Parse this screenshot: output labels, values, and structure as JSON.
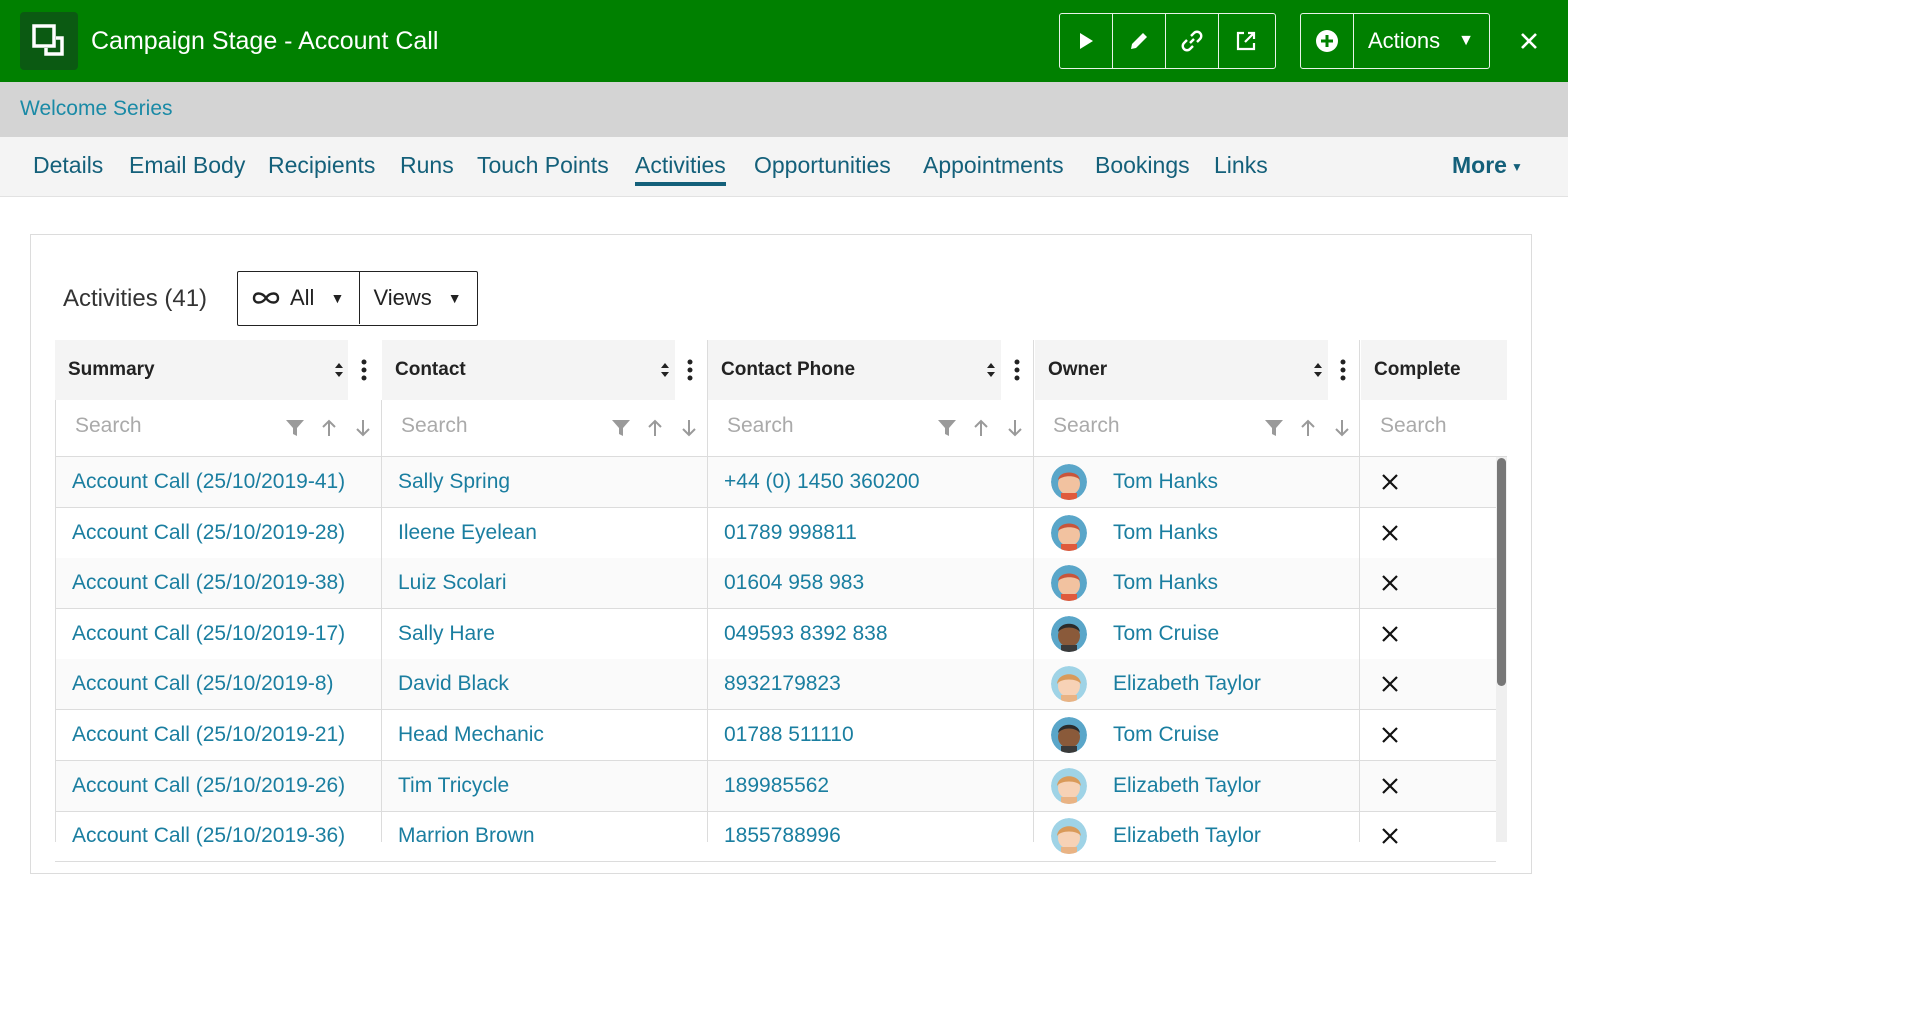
{
  "header": {
    "title": "Campaign Stage - Account Call",
    "toolbar": [
      {
        "name": "run-button",
        "icon": "play-icon"
      },
      {
        "name": "edit-button",
        "icon": "pencil-icon"
      },
      {
        "name": "link-button",
        "icon": "link-icon"
      },
      {
        "name": "open-external-button",
        "icon": "external-link-icon"
      }
    ],
    "actions_label": "Actions",
    "colors": {
      "bar": "#008000",
      "icon_bg": "#0b5a12"
    }
  },
  "breadcrumb": {
    "label": "Welcome Series"
  },
  "tabs": [
    {
      "label": "Details"
    },
    {
      "label": "Email Body"
    },
    {
      "label": "Recipients"
    },
    {
      "label": "Runs"
    },
    {
      "label": "Touch Points"
    },
    {
      "label": "Activities",
      "active": true
    },
    {
      "label": "Opportunities"
    },
    {
      "label": "Appointments"
    },
    {
      "label": "Bookings"
    },
    {
      "label": "Links"
    }
  ],
  "more_label": "More",
  "activities": {
    "title": "Activities",
    "count": "(41)",
    "filter_label": "All",
    "views_label": "Views"
  },
  "columns": [
    {
      "label": "Summary",
      "placeholder": "Search"
    },
    {
      "label": "Contact",
      "placeholder": "Search"
    },
    {
      "label": "Contact Phone",
      "placeholder": "Search"
    },
    {
      "label": "Owner",
      "placeholder": "Search"
    },
    {
      "label": "Complete",
      "placeholder": "Search"
    }
  ],
  "rows": [
    {
      "summary": "Account Call (25/10/2019-41)",
      "contact": "Sally Spring",
      "phone": "+44 (0) 1450 360200",
      "owner": "Tom Hanks",
      "avatar": "hanks"
    },
    {
      "summary": "Account Call (25/10/2019-28)",
      "contact": "Ileene Eyelean",
      "phone": "01789 998811",
      "owner": "Tom Hanks",
      "avatar": "hanks"
    },
    {
      "summary": "Account Call (25/10/2019-38)",
      "contact": "Luiz Scolari",
      "phone": "01604 958 983",
      "owner": "Tom Hanks",
      "avatar": "hanks"
    },
    {
      "summary": "Account Call (25/10/2019-17)",
      "contact": "Sally Hare",
      "phone": "049593 8392 838",
      "owner": "Tom Cruise",
      "avatar": "cruise"
    },
    {
      "summary": "Account Call (25/10/2019-8)",
      "contact": "David Black",
      "phone": "8932179823",
      "owner": "Elizabeth Taylor",
      "avatar": "taylor"
    },
    {
      "summary": "Account Call (25/10/2019-21)",
      "contact": "Head Mechanic",
      "phone": "01788 511110",
      "owner": "Tom Cruise",
      "avatar": "cruise"
    },
    {
      "summary": "Account Call (25/10/2019-26)",
      "contact": "Tim Tricycle",
      "phone": "189985562",
      "owner": "Elizabeth Taylor",
      "avatar": "taylor"
    },
    {
      "summary": "Account Call (25/10/2019-36)",
      "contact": "Marrion Brown",
      "phone": "1855788996",
      "owner": "Elizabeth Taylor",
      "avatar": "taylor"
    }
  ]
}
